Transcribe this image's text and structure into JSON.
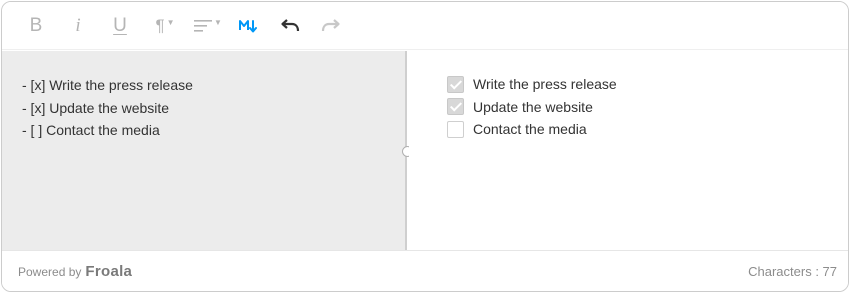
{
  "toolbar": {
    "bold_label": "B",
    "italic_label": "i",
    "underline_label": "U",
    "paragraph_label": "¶",
    "align_icon": "align-left-icon",
    "markdown_icon": "markdown-icon",
    "undo_icon": "undo-icon",
    "redo_icon": "redo-icon",
    "accent_color": "#0098f7"
  },
  "markdown_pane": {
    "lines": [
      "- [x] Write the press release",
      "- [x] Update the website",
      "- [ ] Contact the media"
    ]
  },
  "preview_pane": {
    "tasks": [
      {
        "label": "Write the press release",
        "checked": true
      },
      {
        "label": "Update the website",
        "checked": true
      },
      {
        "label": "Contact the media",
        "checked": false
      }
    ]
  },
  "footer": {
    "powered_by": "Powered by",
    "brand": "Froala",
    "character_count": "Characters : 77"
  }
}
